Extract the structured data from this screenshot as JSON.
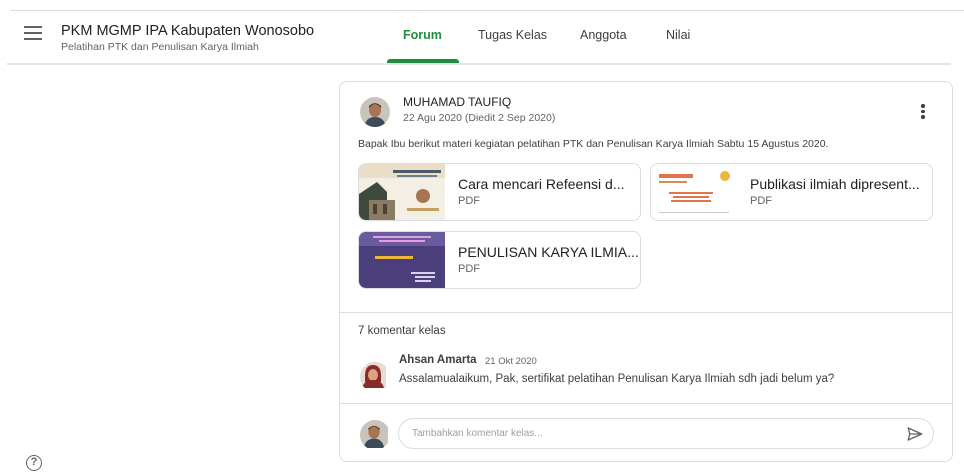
{
  "header": {
    "class_title": "PKM MGMP IPA Kabupaten Wonosobo",
    "class_subtitle": "Pelatihan PTK dan Penulisan Karya Ilmiah",
    "menu_icon": "hamburger-menu-icon",
    "tabs": [
      {
        "label": "Forum",
        "active": true
      },
      {
        "label": "Tugas Kelas",
        "active": false
      },
      {
        "label": "Anggota",
        "active": false
      },
      {
        "label": "Nilai",
        "active": false
      }
    ],
    "accent_color": "#1e8e3e"
  },
  "post": {
    "author": "MUHAMAD TAUFIQ",
    "date": "22 Agu 2020 (Diedit 2 Sep 2020)",
    "text": "Bapak Ibu berikut materi kegiatan pelatihan PTK dan Penulisan Karya Ilmiah Sabtu 15 Agustus 2020.",
    "attachments": [
      {
        "title": "Cara mencari Refeensi d...",
        "type": "PDF"
      },
      {
        "title": "Publikasi ilmiah dipresent...",
        "type": "PDF"
      },
      {
        "title": "PENULISAN KARYA ILMIA...",
        "type": "PDF"
      }
    ],
    "comments_count_label": "7 komentar kelas",
    "comment": {
      "author": "Ahsan Amarta",
      "date": "21 Okt 2020",
      "text": "Assalamualaikum, Pak, sertifikat pelatihan Penulisan Karya Ilmiah sdh jadi belum ya?"
    },
    "comment_input": {
      "placeholder": "Tambahkan komentar kelas...",
      "value": ""
    }
  },
  "footer": {
    "help_icon": "help-icon"
  }
}
